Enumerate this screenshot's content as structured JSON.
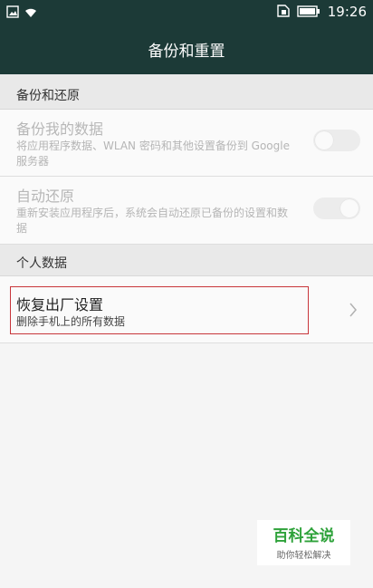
{
  "status_bar": {
    "time": "19:26",
    "icons": [
      "image-icon",
      "wifi-icon",
      "sim-icon",
      "battery-icon"
    ]
  },
  "app_bar": {
    "title": "备份和重置"
  },
  "sections": [
    {
      "header": "备份和还原"
    },
    {
      "header": "个人数据"
    }
  ],
  "backup": {
    "title": "备份我的数据",
    "subtitle": "将应用程序数据、WLAN 密码和其他设置备份到 Google 服务器",
    "toggle": "off",
    "enabled": false
  },
  "restore": {
    "title": "自动还原",
    "subtitle": "重新安装应用程序后，系统会自动还原已备份的设置和数据",
    "toggle": "on",
    "enabled": false
  },
  "factory_reset": {
    "title": "恢复出厂设置",
    "subtitle": "删除手机上的所有数据"
  },
  "watermark": {
    "title": "百科全说",
    "subtitle": "助你轻松解决"
  },
  "colors": {
    "app_bar": "#1c3a37",
    "highlight": "#c8363b",
    "watermark_green": "#2ea23a"
  }
}
